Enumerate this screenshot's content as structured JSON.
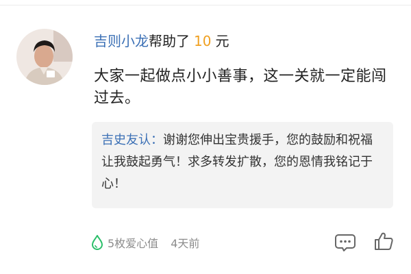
{
  "donation": {
    "donor_name": "吉则小龙",
    "helped_text": "帮助了",
    "amount": "10",
    "unit": "元"
  },
  "comment": {
    "text": "大家一起做点小小善事，这一关就一定能闯过去。"
  },
  "reply": {
    "author": "吉史友认",
    "separator": "：",
    "text": "谢谢您伸出宝贵援手，您的鼓励和祝福让我鼓起勇气！求多转发扩散，您的恩情我铭记于心！"
  },
  "footer": {
    "love_value": "5枚爱心值",
    "time_ago": "4天前"
  },
  "icons": {
    "love": "green-drop-icon",
    "comment": "comment-bubble-icon",
    "like": "thumbs-up-icon"
  },
  "colors": {
    "name": "#3a6fb5",
    "amount": "#f0a020",
    "love_icon": "#2bbf6a",
    "muted": "#8c8c8c"
  }
}
